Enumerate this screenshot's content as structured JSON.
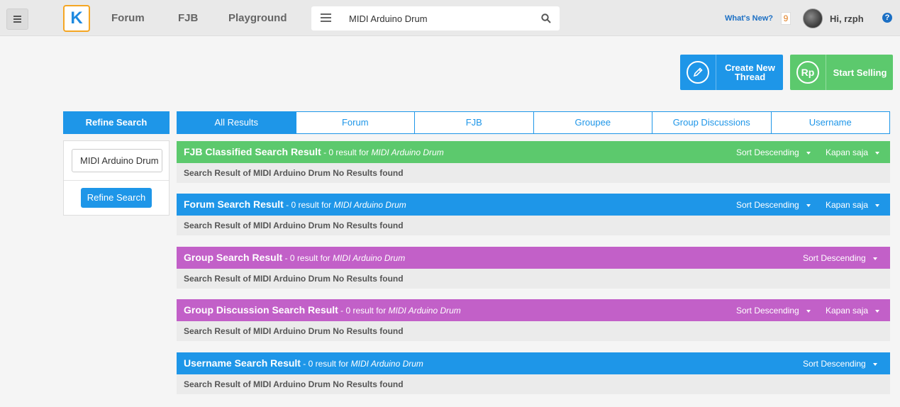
{
  "header": {
    "logo_text": "K",
    "nav": [
      "Forum",
      "FJB",
      "Playground"
    ],
    "search_value": "MIDI Arduino Drum",
    "whats_new": "What's New?",
    "notif_count": "9",
    "greeting": "Hi, rzph",
    "help": "?"
  },
  "actions": {
    "create_label": "Create New Thread",
    "sell_icon": "Rp",
    "sell_label": "Start Selling"
  },
  "refine": {
    "title": "Refine Search",
    "input_value": "MIDI Arduino Drum",
    "button_label": "Refine Search"
  },
  "tabs": [
    "All Results",
    "Forum",
    "FJB",
    "Groupee",
    "Group Discussions",
    "Username"
  ],
  "sections": [
    {
      "title": "FJB Classified Search Result",
      "sub": " - 0 result for ",
      "query": "MIDI Arduino Drum",
      "sort": "Sort Descending",
      "time": "Kapan saja",
      "body": "Search Result of MIDI Arduino Drum No Results found"
    },
    {
      "title": "Forum Search Result",
      "sub": " - 0 result for ",
      "query": "MIDI Arduino Drum",
      "sort": "Sort Descending",
      "time": "Kapan saja",
      "body": "Search Result of MIDI Arduino Drum No Results found"
    },
    {
      "title": "Group Search Result",
      "sub": " - 0 result for ",
      "query": "MIDI Arduino Drum",
      "sort": "Sort Descending",
      "body": "Search Result of MIDI Arduino Drum No Results found"
    },
    {
      "title": "Group Discussion Search Result",
      "sub": " - 0 result for ",
      "query": "MIDI Arduino Drum",
      "sort": "Sort Descending",
      "time": "Kapan saja",
      "body": "Search Result of MIDI Arduino Drum No Results found"
    },
    {
      "title": "Username Search Result",
      "sub": " - 0 result for ",
      "query": "MIDI Arduino Drum",
      "sort": "Sort Descending",
      "body": "Search Result of MIDI Arduino Drum No Results found"
    }
  ],
  "colors": {
    "blue": "#1e96e8",
    "green": "#5cc96d",
    "purple": "#c260c8",
    "logo_border": "#f5a623"
  }
}
